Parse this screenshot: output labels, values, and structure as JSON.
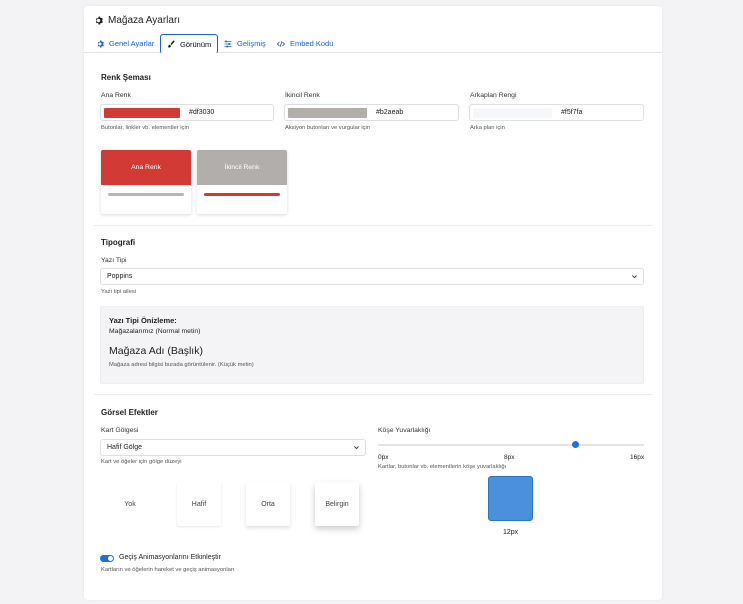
{
  "header": {
    "title": "Mağaza Ayarları"
  },
  "tabs": [
    {
      "label": "Genel Ayarlar",
      "icon": "gear-icon"
    },
    {
      "label": "Görünüm",
      "icon": "brush-icon",
      "active": true
    },
    {
      "label": "Gelişmiş",
      "icon": "sliders-icon"
    },
    {
      "label": "Embed Kodu",
      "icon": "code-icon"
    }
  ],
  "colors_section": {
    "title": "Renk Şeması",
    "primary": {
      "label": "Ana Renk",
      "value": "#df3030",
      "help": "Butonlar, linkler vb. elementler için",
      "swatch": "#d23a36"
    },
    "secondary": {
      "label": "İkincil Renk",
      "value": "#b2aeab",
      "help": "Aksiyon butonları ve vurgular için",
      "swatch": "#b2aeab"
    },
    "background": {
      "label": "Arkaplan Rengi",
      "value": "#f5f7fa",
      "help": "Arka plan için",
      "swatch": "#f5f7fa"
    },
    "preview_primary_label": "Ana Renk",
    "preview_secondary_label": "İkincil Renk"
  },
  "typography": {
    "title": "Tipografi",
    "font_label": "Yazı Tipi",
    "font_value": "Poppins",
    "font_help": "Yazı tipi ailesi",
    "preview_title": "Yazı Tipi Önizleme:",
    "preview_normal": "Mağazalarımız (Normal metin)",
    "preview_heading": "Mağaza Adı (Başlık)",
    "preview_small": "Mağaza adresi bilgisi burada görüntülenir. (Küçük metin)"
  },
  "effects": {
    "title": "Görsel Efektler",
    "shadow_label": "Kart Gölgesi",
    "shadow_value": "Hafif Gölge",
    "shadow_help": "Kart ve öğeler için gölge düzeyi",
    "shadow_options": [
      "Yok",
      "Hafif",
      "Orta",
      "Belirgin"
    ],
    "radius_label": "Köşe Yuvarlaklığı",
    "radius_min": "0px",
    "radius_mid": "8px",
    "radius_max": "16px",
    "radius_help": "Kartlar, butonlar vb. elementlerin köşe yuvarlaklığı",
    "radius_value": 12,
    "radius_display": "12px",
    "animation_label": "Geçiş Animasyonlarını Etkinleştir",
    "animation_help": "Kartların ve öğelerin hareket ve geçiş animasyonları",
    "animation_enabled": true
  },
  "accent_color": "#1f6de0"
}
